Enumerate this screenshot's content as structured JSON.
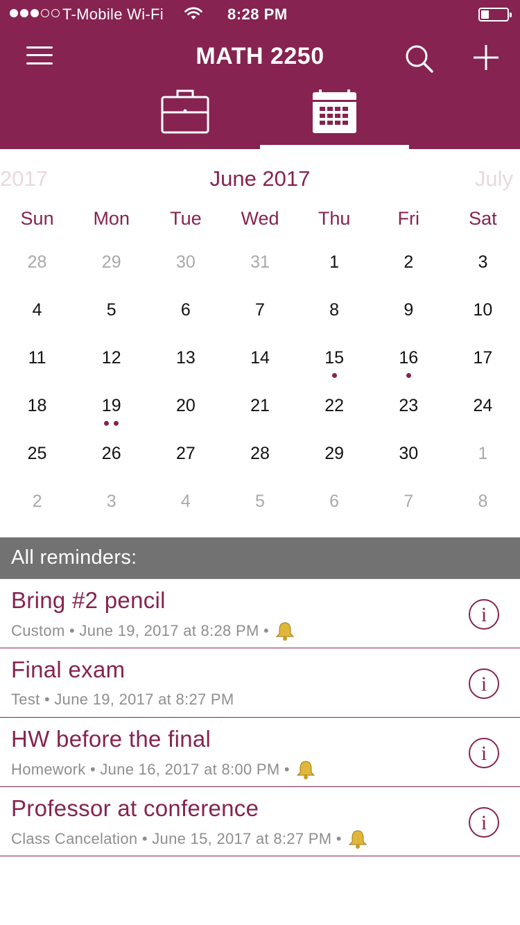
{
  "status_bar": {
    "carrier": "T-Mobile Wi-Fi",
    "time": "8:28 PM",
    "battery_level": 0.3
  },
  "header": {
    "title": "MATH 2250",
    "icons": [
      "menu-icon",
      "search-icon",
      "add-icon"
    ],
    "tabs": [
      {
        "name": "briefcase",
        "icon": "briefcase-icon",
        "selected": false
      },
      {
        "name": "calendar",
        "icon": "calendar-icon",
        "selected": true
      }
    ]
  },
  "colors": {
    "brand": "#862350",
    "section_header": "#727272",
    "muted_text": "#8e8e8e"
  },
  "calendar": {
    "prev_month": "2017",
    "current_month": "June 2017",
    "next_month": "July",
    "weekdays": [
      "Sun",
      "Mon",
      "Tue",
      "Wed",
      "Thu",
      "Fri",
      "Sat"
    ],
    "weeks": [
      [
        {
          "d": "28",
          "out": true
        },
        {
          "d": "29",
          "out": true
        },
        {
          "d": "30",
          "out": true
        },
        {
          "d": "31",
          "out": true
        },
        {
          "d": "1"
        },
        {
          "d": "2"
        },
        {
          "d": "3"
        }
      ],
      [
        {
          "d": "4"
        },
        {
          "d": "5"
        },
        {
          "d": "6"
        },
        {
          "d": "7"
        },
        {
          "d": "8"
        },
        {
          "d": "9"
        },
        {
          "d": "10"
        }
      ],
      [
        {
          "d": "11"
        },
        {
          "d": "12"
        },
        {
          "d": "13"
        },
        {
          "d": "14"
        },
        {
          "d": "15",
          "events": 1
        },
        {
          "d": "16",
          "events": 1
        },
        {
          "d": "17"
        }
      ],
      [
        {
          "d": "18"
        },
        {
          "d": "19",
          "events": 2
        },
        {
          "d": "20"
        },
        {
          "d": "21"
        },
        {
          "d": "22"
        },
        {
          "d": "23"
        },
        {
          "d": "24"
        }
      ],
      [
        {
          "d": "25"
        },
        {
          "d": "26"
        },
        {
          "d": "27"
        },
        {
          "d": "28"
        },
        {
          "d": "29"
        },
        {
          "d": "30"
        },
        {
          "d": "1",
          "out": true
        }
      ],
      [
        {
          "d": "2",
          "out": true
        },
        {
          "d": "3",
          "out": true
        },
        {
          "d": "4",
          "out": true
        },
        {
          "d": "5",
          "out": true
        },
        {
          "d": "6",
          "out": true
        },
        {
          "d": "7",
          "out": true
        },
        {
          "d": "8",
          "out": true
        }
      ]
    ]
  },
  "reminders": {
    "header": "All reminders:",
    "items": [
      {
        "title": "Bring #2 pencil",
        "subtitle": "Custom • June 19, 2017 at 8:28 PM •",
        "bell": true,
        "info_icon": "info-icon"
      },
      {
        "title": "Final exam",
        "subtitle": "Test • June 19, 2017 at 8:27 PM",
        "bell": false,
        "info_icon": "info-icon"
      },
      {
        "title": "HW before the final",
        "subtitle": "Homework • June 16, 2017 at 8:00 PM •",
        "bell": true,
        "info_icon": "info-icon"
      },
      {
        "title": "Professor at conference",
        "subtitle": "Class Cancelation • June 15, 2017 at 8:27 PM •",
        "bell": true,
        "info_icon": "info-icon"
      }
    ]
  }
}
